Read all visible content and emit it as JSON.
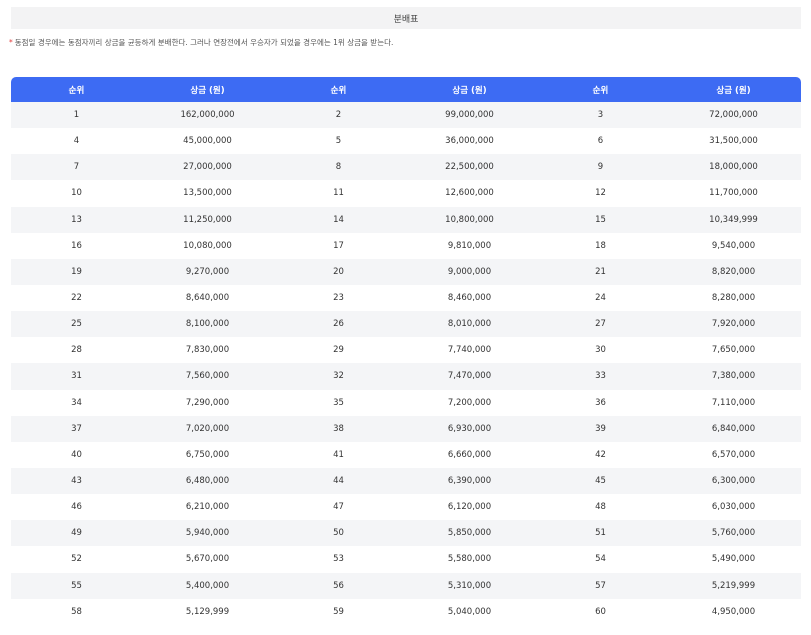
{
  "header": {
    "title": "분배표"
  },
  "notice": {
    "marker": "*",
    "text": "동점일 경우에는 동점자끼리 상금을 균등하게 분배한다. 그러나 연장전에서 우승자가 되었을 경우에는 1위 상금을 받는다."
  },
  "table": {
    "columns": [
      "순위",
      "상금 (원)",
      "순위",
      "상금 (원)",
      "순위",
      "상금 (원)"
    ],
    "rows": [
      [
        "1",
        "162,000,000",
        "2",
        "99,000,000",
        "3",
        "72,000,000"
      ],
      [
        "4",
        "45,000,000",
        "5",
        "36,000,000",
        "6",
        "31,500,000"
      ],
      [
        "7",
        "27,000,000",
        "8",
        "22,500,000",
        "9",
        "18,000,000"
      ],
      [
        "10",
        "13,500,000",
        "11",
        "12,600,000",
        "12",
        "11,700,000"
      ],
      [
        "13",
        "11,250,000",
        "14",
        "10,800,000",
        "15",
        "10,349,999"
      ],
      [
        "16",
        "10,080,000",
        "17",
        "9,810,000",
        "18",
        "9,540,000"
      ],
      [
        "19",
        "9,270,000",
        "20",
        "9,000,000",
        "21",
        "8,820,000"
      ],
      [
        "22",
        "8,640,000",
        "23",
        "8,460,000",
        "24",
        "8,280,000"
      ],
      [
        "25",
        "8,100,000",
        "26",
        "8,010,000",
        "27",
        "7,920,000"
      ],
      [
        "28",
        "7,830,000",
        "29",
        "7,740,000",
        "30",
        "7,650,000"
      ],
      [
        "31",
        "7,560,000",
        "32",
        "7,470,000",
        "33",
        "7,380,000"
      ],
      [
        "34",
        "7,290,000",
        "35",
        "7,200,000",
        "36",
        "7,110,000"
      ],
      [
        "37",
        "7,020,000",
        "38",
        "6,930,000",
        "39",
        "6,840,000"
      ],
      [
        "40",
        "6,750,000",
        "41",
        "6,660,000",
        "42",
        "6,570,000"
      ],
      [
        "43",
        "6,480,000",
        "44",
        "6,390,000",
        "45",
        "6,300,000"
      ],
      [
        "46",
        "6,210,000",
        "47",
        "6,120,000",
        "48",
        "6,030,000"
      ],
      [
        "49",
        "5,940,000",
        "50",
        "5,850,000",
        "51",
        "5,760,000"
      ],
      [
        "52",
        "5,670,000",
        "53",
        "5,580,000",
        "54",
        "5,490,000"
      ],
      [
        "55",
        "5,400,000",
        "56",
        "5,310,000",
        "57",
        "5,219,999"
      ],
      [
        "58",
        "5,129,999",
        "59",
        "5,040,000",
        "60",
        "4,950,000"
      ]
    ]
  },
  "colors": {
    "header_bg": "#3d6bf3",
    "title_bg": "#f3f3f4",
    "stripe": "#f4f5f7",
    "notice_marker": "#e23b3b"
  }
}
